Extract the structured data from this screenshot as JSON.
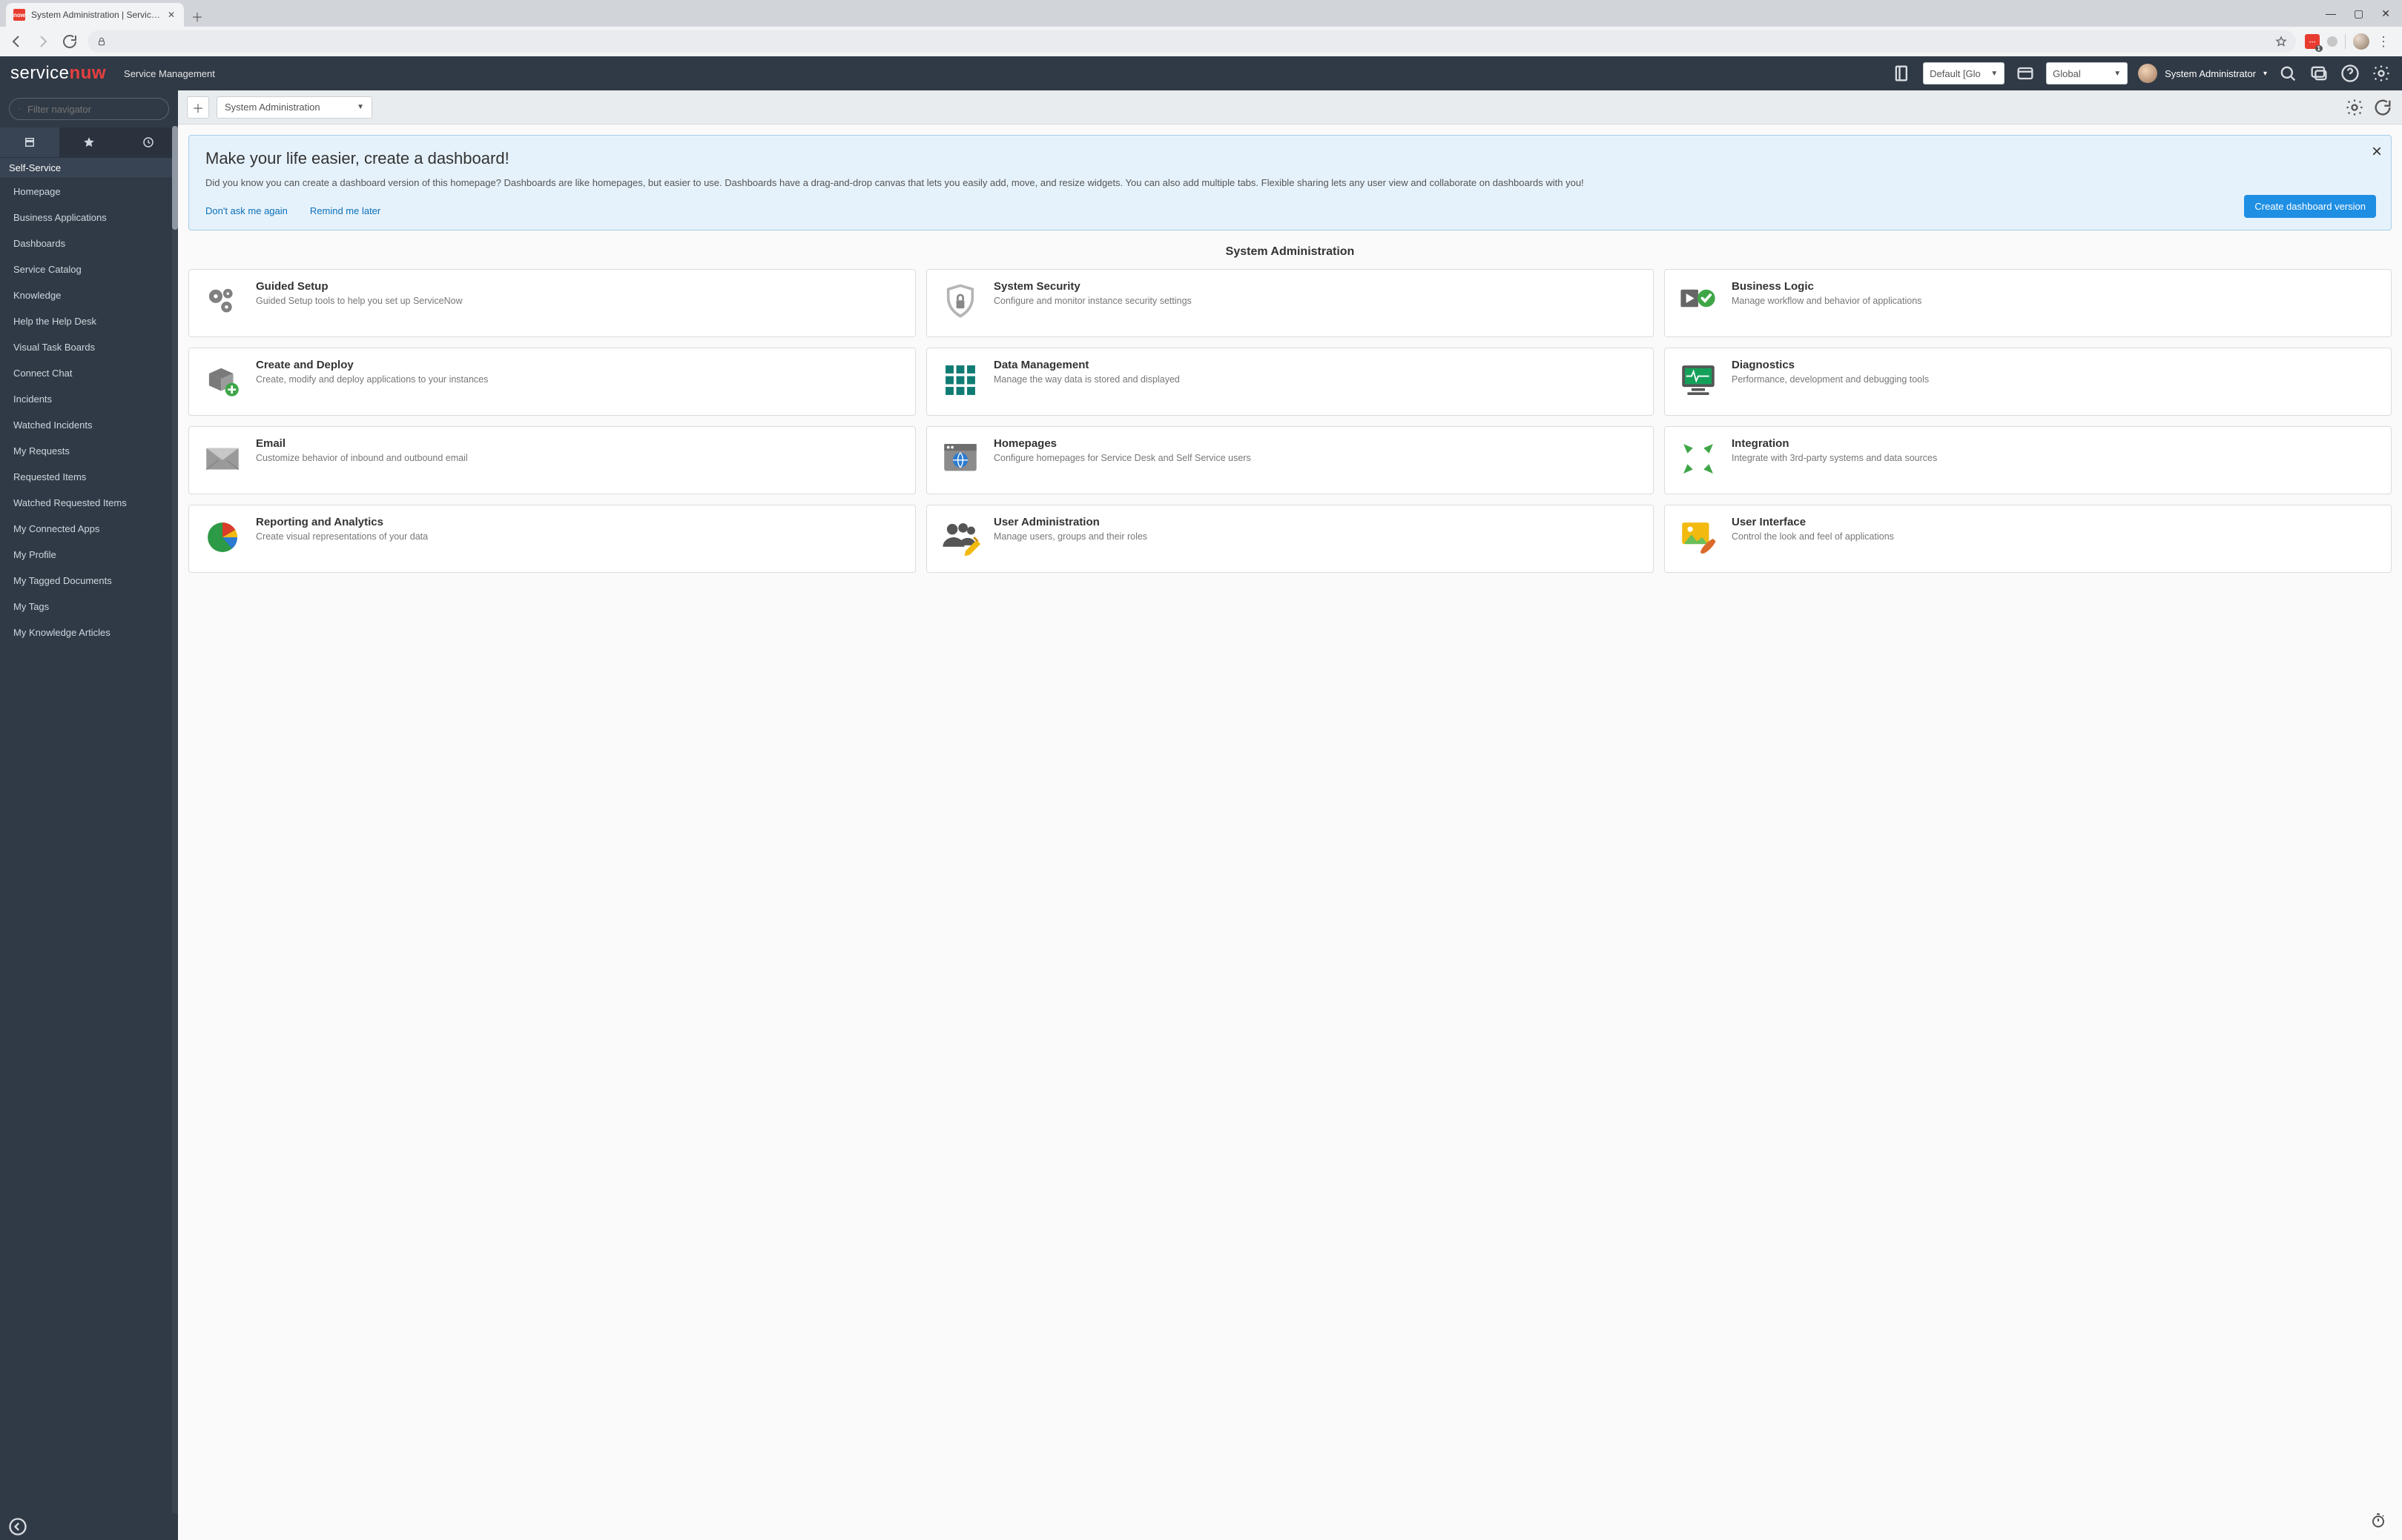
{
  "browser": {
    "tab_title": "System Administration | ServiceN",
    "address": ""
  },
  "header": {
    "subtitle": "Service Management",
    "domain_select": "Default [Glo",
    "scope_select": "Global",
    "user_name": "System Administrator"
  },
  "sidebar": {
    "filter_placeholder": "Filter navigator",
    "section": "Self-Service",
    "items": [
      "Homepage",
      "Business Applications",
      "Dashboards",
      "Service Catalog",
      "Knowledge",
      "Help the Help Desk",
      "Visual Task Boards",
      "Connect Chat",
      "Incidents",
      "Watched Incidents",
      "My Requests",
      "Requested Items",
      "Watched Requested Items",
      "My Connected Apps",
      "My Profile",
      "My Tagged Documents",
      "My Tags",
      "My Knowledge Articles"
    ]
  },
  "content": {
    "page_select": "System Administration",
    "alert": {
      "title": "Make your life easier, create a dashboard!",
      "body": "Did you know you can create a dashboard version of this homepage? Dashboards are like homepages, but easier to use. Dashboards have a drag-and-drop canvas that lets you easily add, move, and resize widgets. You can also add multiple tabs. Flexible sharing lets any user view and collaborate on dashboards with you!",
      "dont_ask": "Don't ask me again",
      "remind": "Remind me later",
      "create_btn": "Create dashboard version"
    },
    "section_title": "System Administration",
    "cards": [
      {
        "title": "Guided Setup",
        "desc": "Guided Setup tools to help you set up ServiceNow"
      },
      {
        "title": "System Security",
        "desc": "Configure and monitor instance security settings"
      },
      {
        "title": "Business Logic",
        "desc": "Manage workflow and behavior of applications"
      },
      {
        "title": "Create and Deploy",
        "desc": "Create, modify and deploy applications to your instances"
      },
      {
        "title": "Data Management",
        "desc": "Manage the way data is stored and displayed"
      },
      {
        "title": "Diagnostics",
        "desc": "Performance, development and debugging tools"
      },
      {
        "title": "Email",
        "desc": "Customize behavior of inbound and outbound email"
      },
      {
        "title": "Homepages",
        "desc": "Configure homepages for Service Desk and Self Service users"
      },
      {
        "title": "Integration",
        "desc": "Integrate with 3rd-party systems and data sources"
      },
      {
        "title": "Reporting and Analytics",
        "desc": "Create visual representations of your data"
      },
      {
        "title": "User Administration",
        "desc": "Manage users, groups and their roles"
      },
      {
        "title": "User Interface",
        "desc": "Control the look and feel of applications"
      }
    ]
  }
}
